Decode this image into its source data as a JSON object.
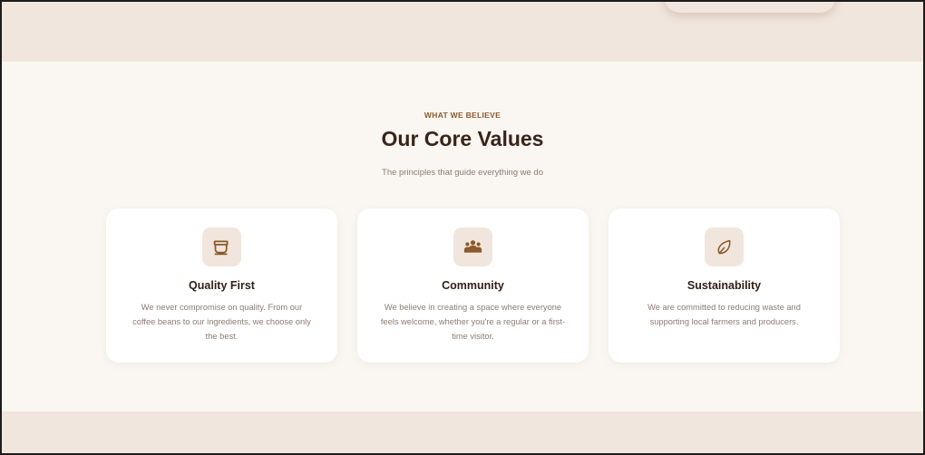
{
  "colors": {
    "band": "#f1e6dd",
    "section_bg": "#faf7f2",
    "accent": "#8a5a2b",
    "heading": "#3a2418",
    "muted_text": "#8c7b72",
    "card_bg": "#ffffff"
  },
  "values_section": {
    "eyebrow": "WHAT WE BELIEVE",
    "title": "Our Core Values",
    "subtitle": "The principles that guide everything we do",
    "cards": [
      {
        "icon": "coffee-cup-icon",
        "title": "Quality First",
        "description": "We never compromise on quality. From our coffee beans to our ingredients, we choose only the best."
      },
      {
        "icon": "people-icon",
        "title": "Community",
        "description": "We believe in creating a space where everyone feels welcome, whether you're a regular or a first-time visitor."
      },
      {
        "icon": "leaf-icon",
        "title": "Sustainability",
        "description": "We are committed to reducing waste and supporting local farmers and producers."
      }
    ]
  }
}
